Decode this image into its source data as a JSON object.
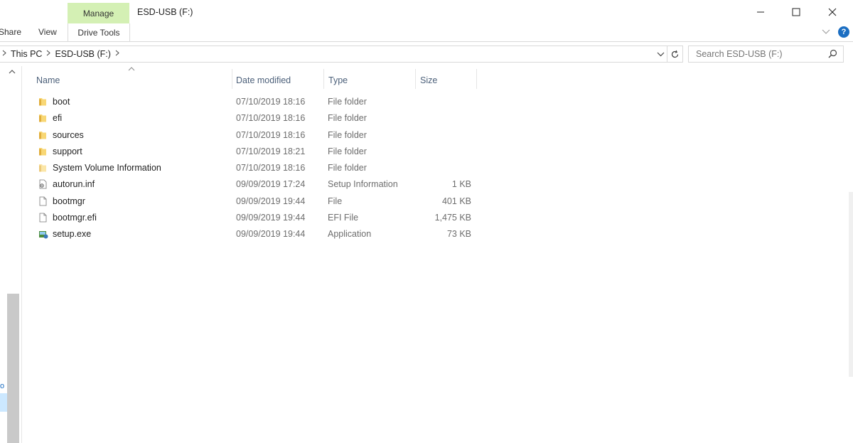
{
  "window": {
    "title": "ESD-USB (F:)",
    "controls": {
      "minimize": "minimize",
      "maximize": "maximize",
      "close": "close"
    }
  },
  "ribbon": {
    "tabs": {
      "share": "Share",
      "view": "View",
      "manage": "Manage",
      "drive_tools": "Drive Tools"
    },
    "accent_color": "#d4f0b4"
  },
  "address": {
    "crumbs": [
      "This PC",
      "ESD-USB (F:)"
    ],
    "search_placeholder": "Search ESD-USB (F:)"
  },
  "columns": {
    "name": "Name",
    "date": "Date modified",
    "type": "Type",
    "size": "Size"
  },
  "files": [
    {
      "icon": "folder-icon",
      "name": "boot",
      "date": "07/10/2019 18:16",
      "type": "File folder",
      "size": ""
    },
    {
      "icon": "folder-icon",
      "name": "efi",
      "date": "07/10/2019 18:16",
      "type": "File folder",
      "size": ""
    },
    {
      "icon": "folder-icon",
      "name": "sources",
      "date": "07/10/2019 18:16",
      "type": "File folder",
      "size": ""
    },
    {
      "icon": "folder-icon",
      "name": "support",
      "date": "07/10/2019 18:21",
      "type": "File folder",
      "size": ""
    },
    {
      "icon": "folder-icon",
      "name": "System Volume Information",
      "date": "07/10/2019 18:16",
      "type": "File folder",
      "size": ""
    },
    {
      "icon": "setup-info-icon",
      "name": "autorun.inf",
      "date": "09/09/2019 17:24",
      "type": "Setup Information",
      "size": "1 KB"
    },
    {
      "icon": "file-icon",
      "name": "bootmgr",
      "date": "09/09/2019 19:44",
      "type": "File",
      "size": "401 KB"
    },
    {
      "icon": "file-icon",
      "name": "bootmgr.efi",
      "date": "09/09/2019 19:44",
      "type": "EFI File",
      "size": "1,475 KB"
    },
    {
      "icon": "setup-exe-icon",
      "name": "setup.exe",
      "date": "09/09/2019 19:44",
      "type": "Application",
      "size": "73 KB"
    }
  ]
}
